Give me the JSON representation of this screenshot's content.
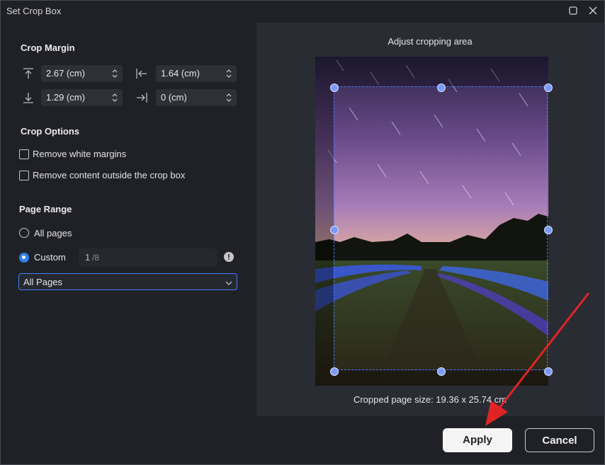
{
  "window": {
    "title": "Set Crop Box",
    "maximize_icon": "square-icon",
    "close_icon": "close-icon"
  },
  "crop_margin": {
    "heading": "Crop Margin",
    "top": "2.67 (cm)",
    "left": "1.64 (cm)",
    "bottom": "1.29 (cm)",
    "right": "0 (cm)"
  },
  "crop_options": {
    "heading": "Crop Options",
    "remove_white_margins": "Remove white margins",
    "remove_outside": "Remove content outside the crop box"
  },
  "page_range": {
    "heading": "Page Range",
    "all_pages": "All pages",
    "custom": "Custom",
    "custom_value": "1",
    "custom_total": "/8",
    "select_value": "All Pages"
  },
  "preview": {
    "title": "Adjust cropping area",
    "cropped_size": "Cropped page size: 19.36 x 25.74 cm"
  },
  "buttons": {
    "apply": "Apply",
    "cancel": "Cancel"
  },
  "colors": {
    "accent": "#2f80ed",
    "annotation_arrow": "#e02424"
  }
}
